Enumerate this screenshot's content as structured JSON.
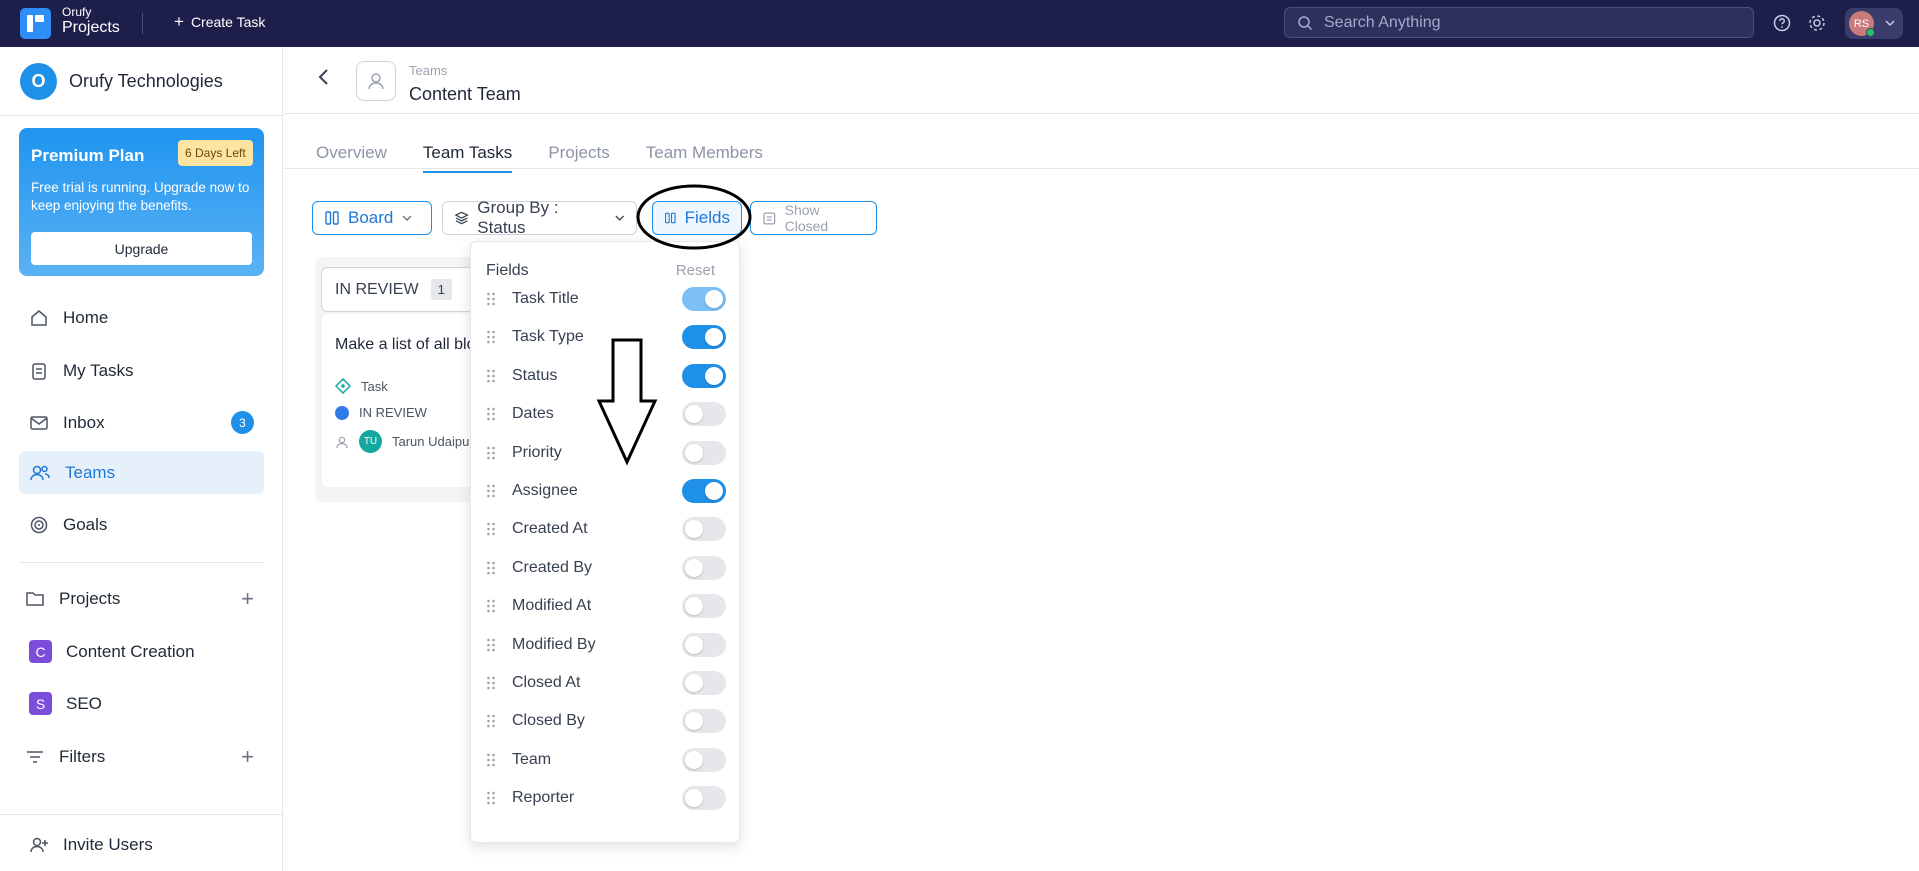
{
  "topbar": {
    "logo_small": "Orufy",
    "logo_big": "Projects",
    "create_task": "Create Task",
    "search_placeholder": "Search Anything",
    "avatar_initials": "RS"
  },
  "sidebar": {
    "org_initial": "O",
    "org_name": "Orufy Technologies",
    "plan": {
      "title": "Premium Plan",
      "badge": "6 Days Left",
      "description": "Free trial is running. Upgrade now to keep enjoying the benefits.",
      "button": "Upgrade"
    },
    "nav": [
      {
        "label": "Home",
        "icon": "home-icon"
      },
      {
        "label": "My Tasks",
        "icon": "clipboard-icon"
      },
      {
        "label": "Inbox",
        "icon": "mail-icon",
        "badge": "3"
      },
      {
        "label": "Teams",
        "icon": "users-icon",
        "active": true
      },
      {
        "label": "Goals",
        "icon": "target-icon"
      }
    ],
    "projects_label": "Projects",
    "projects": [
      {
        "initial": "C",
        "label": "Content Creation"
      },
      {
        "initial": "S",
        "label": "SEO"
      }
    ],
    "filters_label": "Filters",
    "invite_label": "Invite Users"
  },
  "header": {
    "breadcrumb": "Teams",
    "title": "Content Team"
  },
  "tabs": [
    {
      "label": "Overview",
      "active": false
    },
    {
      "label": "Team Tasks",
      "active": true
    },
    {
      "label": "Projects",
      "active": false
    },
    {
      "label": "Team Members",
      "active": false
    }
  ],
  "toolbar": {
    "board": "Board",
    "group_by": "Group By : Status",
    "fields": "Fields",
    "show_closed": "Show Closed"
  },
  "board": {
    "column_title": "IN REVIEW",
    "column_count": "1",
    "card": {
      "title": "Make a list of all blogs",
      "type": "Task",
      "status": "IN REVIEW",
      "assignee_initials": "TU",
      "assignee": "Tarun Udaipuri"
    }
  },
  "fields_panel": {
    "title": "Fields",
    "reset": "Reset",
    "fields": [
      {
        "label": "Task Title",
        "state": "locked-on"
      },
      {
        "label": "Task Type",
        "state": "on"
      },
      {
        "label": "Status",
        "state": "on"
      },
      {
        "label": "Dates",
        "state": "off"
      },
      {
        "label": "Priority",
        "state": "off"
      },
      {
        "label": "Assignee",
        "state": "on"
      },
      {
        "label": "Created At",
        "state": "off"
      },
      {
        "label": "Created By",
        "state": "off"
      },
      {
        "label": "Modified At",
        "state": "off"
      },
      {
        "label": "Modified By",
        "state": "off"
      },
      {
        "label": "Closed At",
        "state": "off"
      },
      {
        "label": "Closed By",
        "state": "off"
      },
      {
        "label": "Team",
        "state": "off"
      },
      {
        "label": "Reporter",
        "state": "off"
      }
    ]
  },
  "colors": {
    "topbar": "#1d1f4a",
    "accent": "#1e90e8",
    "project_badge": "#7c4ddb"
  }
}
